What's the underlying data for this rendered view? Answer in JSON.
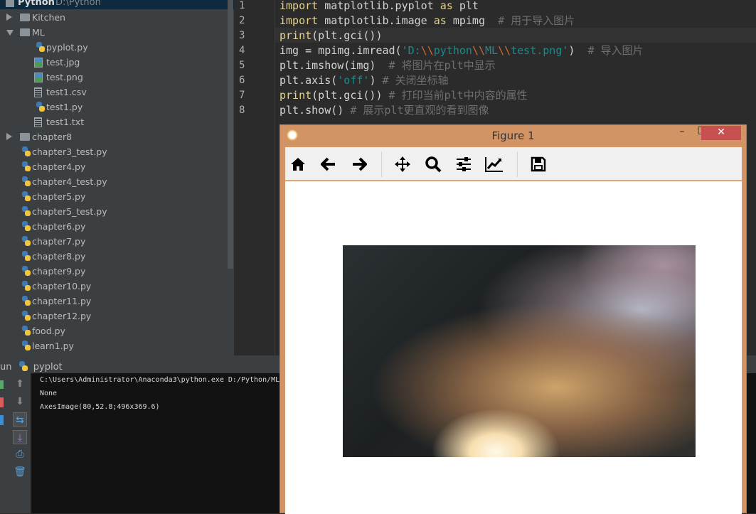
{
  "project": {
    "name": "Python",
    "path": "D:\\Python",
    "items": [
      {
        "label": "Kitchen",
        "type": "folder",
        "state": "collapsed",
        "indent": 0
      },
      {
        "label": "ML",
        "type": "folder",
        "state": "expanded",
        "indent": 0
      },
      {
        "label": "pyplot.py",
        "type": "python",
        "indent": 1
      },
      {
        "label": "test.jpg",
        "type": "image",
        "indent": 1
      },
      {
        "label": "test.png",
        "type": "image",
        "indent": 1
      },
      {
        "label": "test1.csv",
        "type": "text",
        "indent": 1
      },
      {
        "label": "test1.py",
        "type": "python",
        "indent": 1
      },
      {
        "label": "test1.txt",
        "type": "text",
        "indent": 1
      },
      {
        "label": "chapter8",
        "type": "folder",
        "state": "collapsed",
        "indent": 0
      },
      {
        "label": "chapter3_test.py",
        "type": "python",
        "indent": 0
      },
      {
        "label": "chapter4.py",
        "type": "python",
        "indent": 0
      },
      {
        "label": "chapter4_test.py",
        "type": "python",
        "indent": 0
      },
      {
        "label": "chapter5.py",
        "type": "python",
        "indent": 0
      },
      {
        "label": "chapter5_test.py",
        "type": "python",
        "indent": 0
      },
      {
        "label": "chapter6.py",
        "type": "python",
        "indent": 0
      },
      {
        "label": "chapter7.py",
        "type": "python",
        "indent": 0
      },
      {
        "label": "chapter8.py",
        "type": "python",
        "indent": 0
      },
      {
        "label": "chapter9.py",
        "type": "python",
        "indent": 0
      },
      {
        "label": "chapter10.py",
        "type": "python",
        "indent": 0
      },
      {
        "label": "chapter11.py",
        "type": "python",
        "indent": 0
      },
      {
        "label": "chapter12.py",
        "type": "python",
        "indent": 0
      },
      {
        "label": "food.py",
        "type": "python",
        "indent": 0
      },
      {
        "label": "learn1.py",
        "type": "python",
        "indent": 0
      }
    ]
  },
  "editor": {
    "current_line": 3,
    "lines": [
      {
        "n": "1",
        "tokens": [
          [
            "k",
            "import"
          ],
          [
            "t",
            " matplotlib.pyplot "
          ],
          [
            "k",
            "as"
          ],
          [
            "t",
            " plt"
          ]
        ]
      },
      {
        "n": "2",
        "tokens": [
          [
            "k",
            "import"
          ],
          [
            "t",
            " matplotlib.image "
          ],
          [
            "k",
            "as"
          ],
          [
            "t",
            " mpimg  "
          ],
          [
            "c",
            "# 用于导入图片"
          ]
        ]
      },
      {
        "n": "3",
        "tokens": [
          [
            "k",
            "print"
          ],
          [
            "t",
            "(plt.gci())"
          ]
        ]
      },
      {
        "n": "4",
        "tokens": [
          [
            "t",
            "img = mpimg.imread("
          ],
          [
            "s",
            "'D:"
          ],
          [
            "e",
            "\\\\"
          ],
          [
            "s",
            "python"
          ],
          [
            "e",
            "\\\\"
          ],
          [
            "s",
            "ML"
          ],
          [
            "e",
            "\\\\"
          ],
          [
            "s",
            "test.png'"
          ],
          [
            "t",
            ")  "
          ],
          [
            "c",
            "# 导入图片"
          ]
        ]
      },
      {
        "n": "5",
        "tokens": [
          [
            "t",
            "plt.imshow(img)  "
          ],
          [
            "c",
            "# 将图片在plt中显示"
          ]
        ]
      },
      {
        "n": "6",
        "tokens": [
          [
            "t",
            "plt.axis("
          ],
          [
            "s",
            "'off'"
          ],
          [
            "t",
            ") "
          ],
          [
            "c",
            "# 关闭坐标轴"
          ]
        ]
      },
      {
        "n": "7",
        "tokens": [
          [
            "k",
            "print"
          ],
          [
            "t",
            "(plt.gci()) "
          ],
          [
            "c",
            "# 打印当前plt中内容的属性"
          ]
        ]
      },
      {
        "n": "8",
        "tokens": [
          [
            "t",
            "plt.show() "
          ],
          [
            "c",
            "# 展示plt更直观的看到图像"
          ]
        ]
      }
    ]
  },
  "run": {
    "tab_prefix": "un",
    "tab_label": "pyplot",
    "output": [
      "C:\\Users\\Administrator\\Anaconda3\\python.exe D:/Python/ML/",
      "None",
      "AxesImage(80,52.8;496x369.6)"
    ]
  },
  "figure": {
    "title": "Figure 1",
    "minimize": "–",
    "maximize": "□",
    "close": "✕",
    "toolbar": [
      "home-icon",
      "back-arrow-icon",
      "forward-arrow-icon",
      "pan-icon",
      "zoom-icon",
      "subplots-config-icon",
      "edit-axis-icon",
      "save-icon"
    ],
    "image_file": "test.png"
  }
}
